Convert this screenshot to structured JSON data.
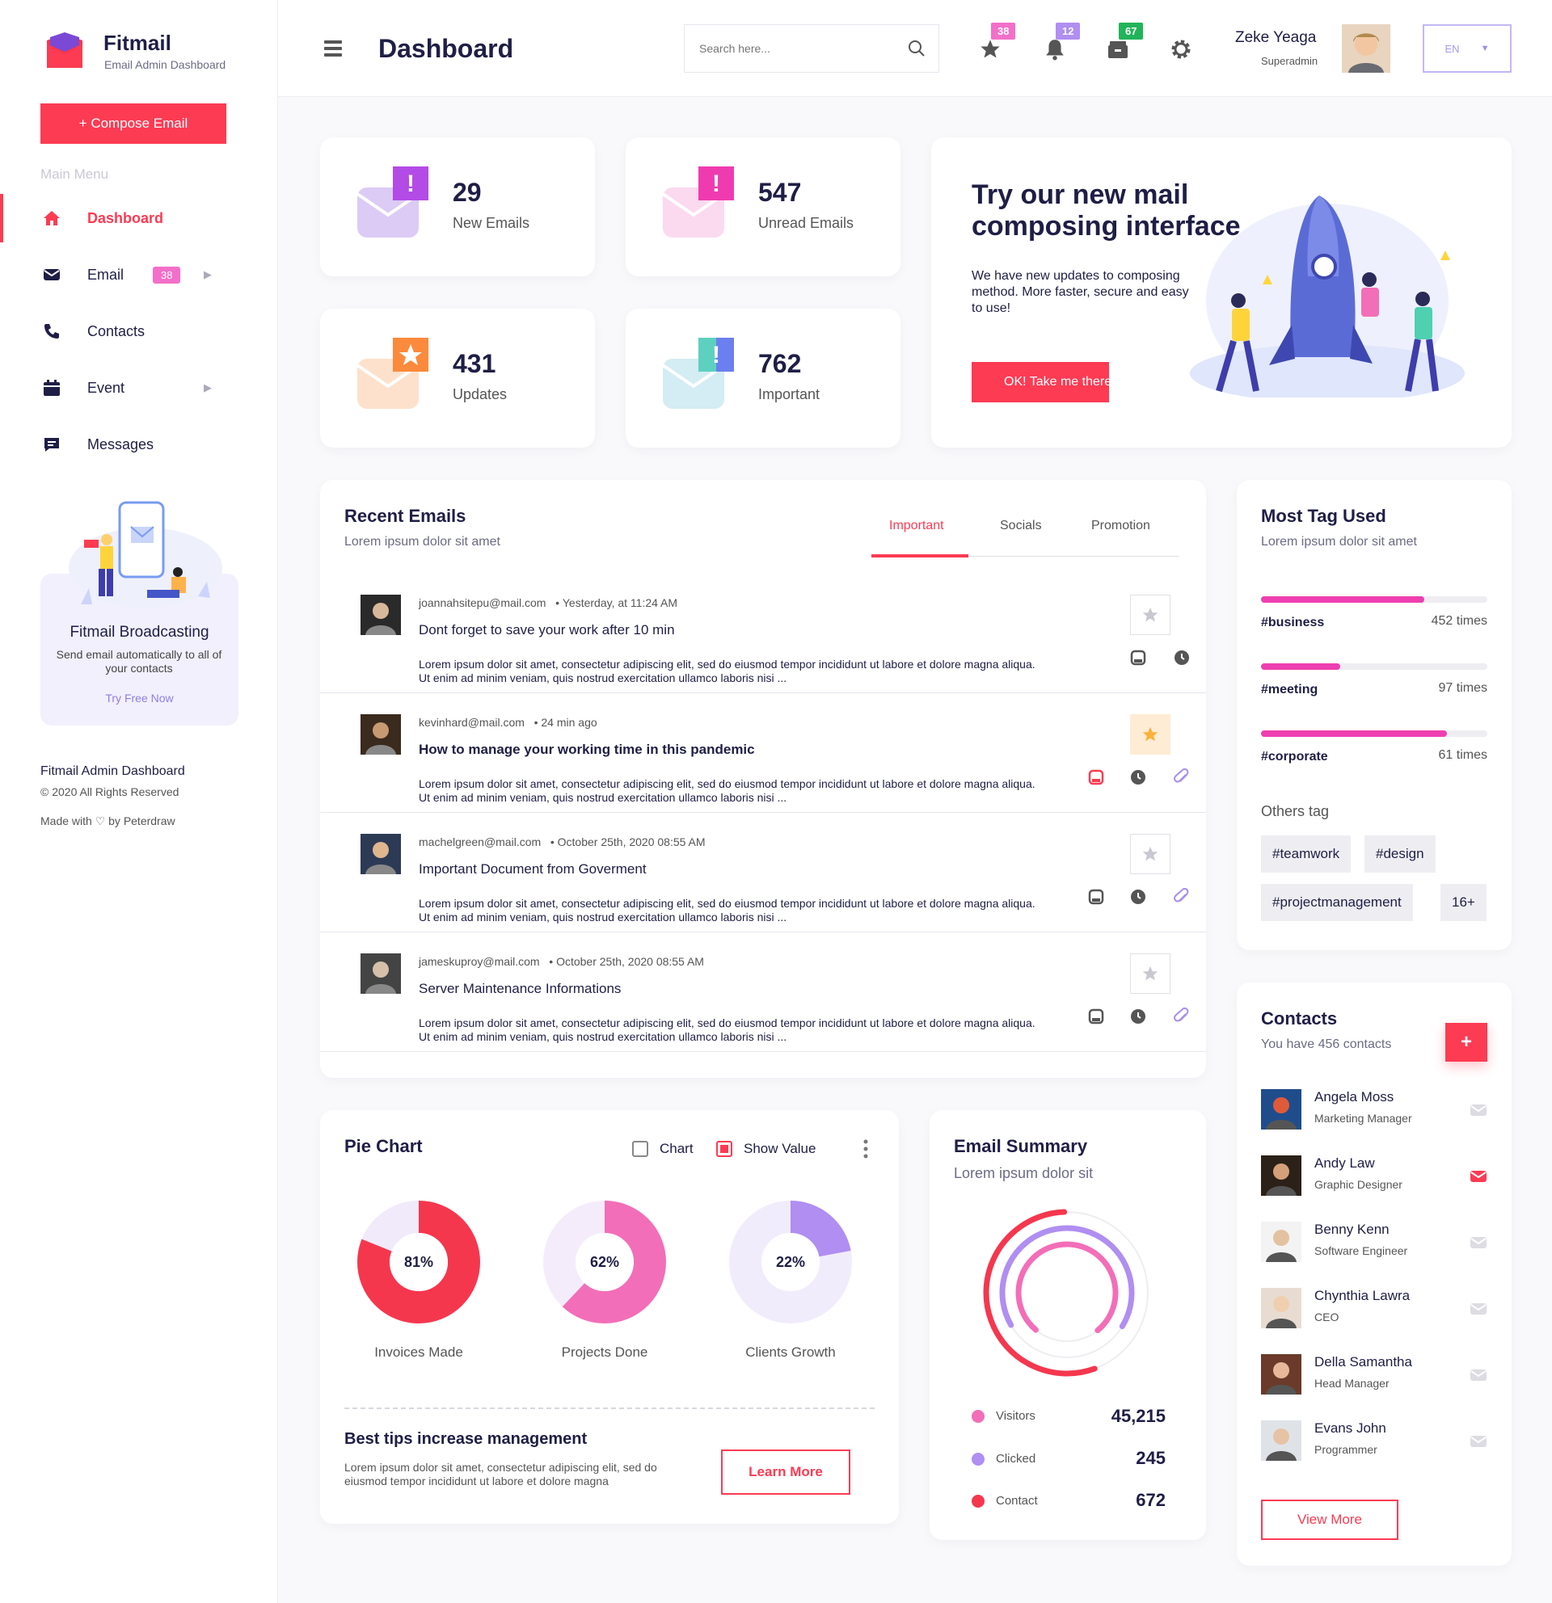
{
  "sidebar": {
    "brand_name": "Fitmail",
    "brand_sub": "Email Admin Dashboard",
    "compose_label": "+ Compose Email",
    "menu_title": "Main Menu",
    "items": [
      {
        "label": "Dashboard",
        "icon": "home-icon",
        "active": true
      },
      {
        "label": "Email",
        "icon": "envelope-icon",
        "badge": "38"
      },
      {
        "label": "Contacts",
        "icon": "phone-icon"
      },
      {
        "label": "Event",
        "icon": "calendar-icon"
      },
      {
        "label": "Messages",
        "icon": "chat-icon"
      }
    ],
    "promo": {
      "title": "Fitmail Broadcasting",
      "text": "Send email automatically to all of your contacts",
      "link": "Try Free Now"
    },
    "footer": {
      "title": "Fitmail Admin Dashboard",
      "copyright": "© 2020 All Rights Reserved",
      "made_with": "Made with ♡ by Peterdraw"
    }
  },
  "header": {
    "title": "Dashboard",
    "search_placeholder": "Search here...",
    "badges": {
      "star": "38",
      "bell": "12",
      "archive": "67"
    },
    "user_name": "Zeke Yeaga",
    "user_role": "Superadmin",
    "language": "EN"
  },
  "stats": [
    {
      "value": "29",
      "label": "New Emails",
      "color": "#c061f0"
    },
    {
      "value": "547",
      "label": "Unread Emails",
      "color": "#f03bb0"
    },
    {
      "value": "431",
      "label": "Updates",
      "color": "#fb8a3c"
    },
    {
      "value": "762",
      "label": "Important",
      "color": "#4fb6d8"
    }
  ],
  "hero": {
    "title": "Try our new mail composing interface",
    "text": "We have new updates to composing method. More faster, secure and easy to use!",
    "button": "OK! Take me there"
  },
  "recent_emails": {
    "title": "Recent Emails",
    "subtitle": "Lorem ipsum dolor sit amet",
    "tabs": [
      "Important",
      "Socials",
      "Promotion"
    ],
    "items": [
      {
        "from": "joannahsitepu@mail.com",
        "time": "Yesterday, at 11:24 AM",
        "subject": "Dont forget to save your work after 10 min",
        "body": "Lorem ipsum dolor sit amet, consectetur adipiscing elit, sed do eiusmod tempor incididunt ut labore et dolore magna aliqua. Ut enim ad minim veniam, quis nostrud exercitation ullamco laboris nisi ...",
        "starred": false,
        "bold": false,
        "attachment": false
      },
      {
        "from": "kevinhard@mail.com",
        "time": "24 min ago",
        "subject": "How to manage your working time in this pandemic",
        "body": "Lorem ipsum dolor sit amet, consectetur adipiscing elit, sed do eiusmod tempor incididunt ut labore et dolore magna aliqua. Ut enim ad minim veniam, quis nostrud exercitation ullamco laboris nisi ...",
        "starred": true,
        "bold": true,
        "attachment": true
      },
      {
        "from": "machelgreen@mail.com",
        "time": "October 25th, 2020  08:55 AM",
        "subject": "Important Document from Goverment",
        "body": "Lorem ipsum dolor sit amet, consectetur adipiscing elit, sed do eiusmod tempor incididunt ut labore et dolore magna aliqua. Ut enim ad minim veniam, quis nostrud exercitation ullamco laboris nisi ...",
        "starred": false,
        "bold": false,
        "attachment": true
      },
      {
        "from": "jameskuproy@mail.com",
        "time": "October 25th, 2020  08:55 AM",
        "subject": "Server Maintenance Informations",
        "body": "Lorem ipsum dolor sit amet, consectetur adipiscing elit, sed do eiusmod tempor incididunt ut labore et dolore magna aliqua. Ut enim ad minim veniam, quis nostrud exercitation ullamco laboris nisi ...",
        "starred": false,
        "bold": false,
        "attachment": true
      }
    ]
  },
  "tags": {
    "title": "Most Tag Used",
    "subtitle": "Lorem ipsum dolor sit amet",
    "items": [
      {
        "name": "#business",
        "count": "452 times",
        "fraction": 0.72
      },
      {
        "name": "#meeting",
        "count": "97 times",
        "fraction": 0.35
      },
      {
        "name": "#corporate",
        "count": "61 times",
        "fraction": 0.82
      }
    ],
    "others_title": "Others tag",
    "others": [
      "#teamwork",
      "#design",
      "#projectmanagement",
      "16+"
    ]
  },
  "contacts": {
    "title": "Contacts",
    "subtitle": "You have 456 contacts",
    "add_label": "+",
    "items": [
      {
        "name": "Angela Moss",
        "role": "Marketing Manager",
        "highlight": false
      },
      {
        "name": "Andy Law",
        "role": "Graphic Designer",
        "highlight": true
      },
      {
        "name": "Benny Kenn",
        "role": "Software Engineer",
        "highlight": false
      },
      {
        "name": "Chynthia Lawra",
        "role": "CEO",
        "highlight": false
      },
      {
        "name": "Della Samantha",
        "role": "Head Manager",
        "highlight": false
      },
      {
        "name": "Evans John",
        "role": "Programmer",
        "highlight": false
      }
    ],
    "view_more": "View More"
  },
  "pie": {
    "title": "Pie Chart",
    "option_chart": "Chart",
    "option_show_value": "Show Value",
    "donuts": [
      {
        "value": 81,
        "label": "81%",
        "name": "Invoices Made",
        "color": "#f5374e",
        "track": "#f1eafb"
      },
      {
        "value": 62,
        "label": "62%",
        "name": "Projects Done",
        "color": "#f36eb8",
        "track": "#f4ecfb"
      },
      {
        "value": 22,
        "label": "22%",
        "name": "Clients Growth",
        "color": "#b08ef2",
        "track": "#f1ecfb"
      }
    ],
    "tips_title": "Best tips increase management",
    "tips_text": "Lorem ipsum dolor sit amet, consectetur adipiscing elit, sed do eiusmod tempor incididunt ut labore et dolore magna",
    "learn_more": "Learn More"
  },
  "summary": {
    "title": "Email Summary",
    "subtitle": "Lorem ipsum dolor sit",
    "items": [
      {
        "name": "Visitors",
        "value": "45,215",
        "color": "#f36eb8",
        "fraction": 0.78
      },
      {
        "name": "Clicked",
        "value": "245",
        "color": "#b08ef2",
        "fraction": 0.67
      },
      {
        "name": "Contact",
        "value": "672",
        "color": "#f5374e",
        "fraction": 0.55
      }
    ]
  }
}
